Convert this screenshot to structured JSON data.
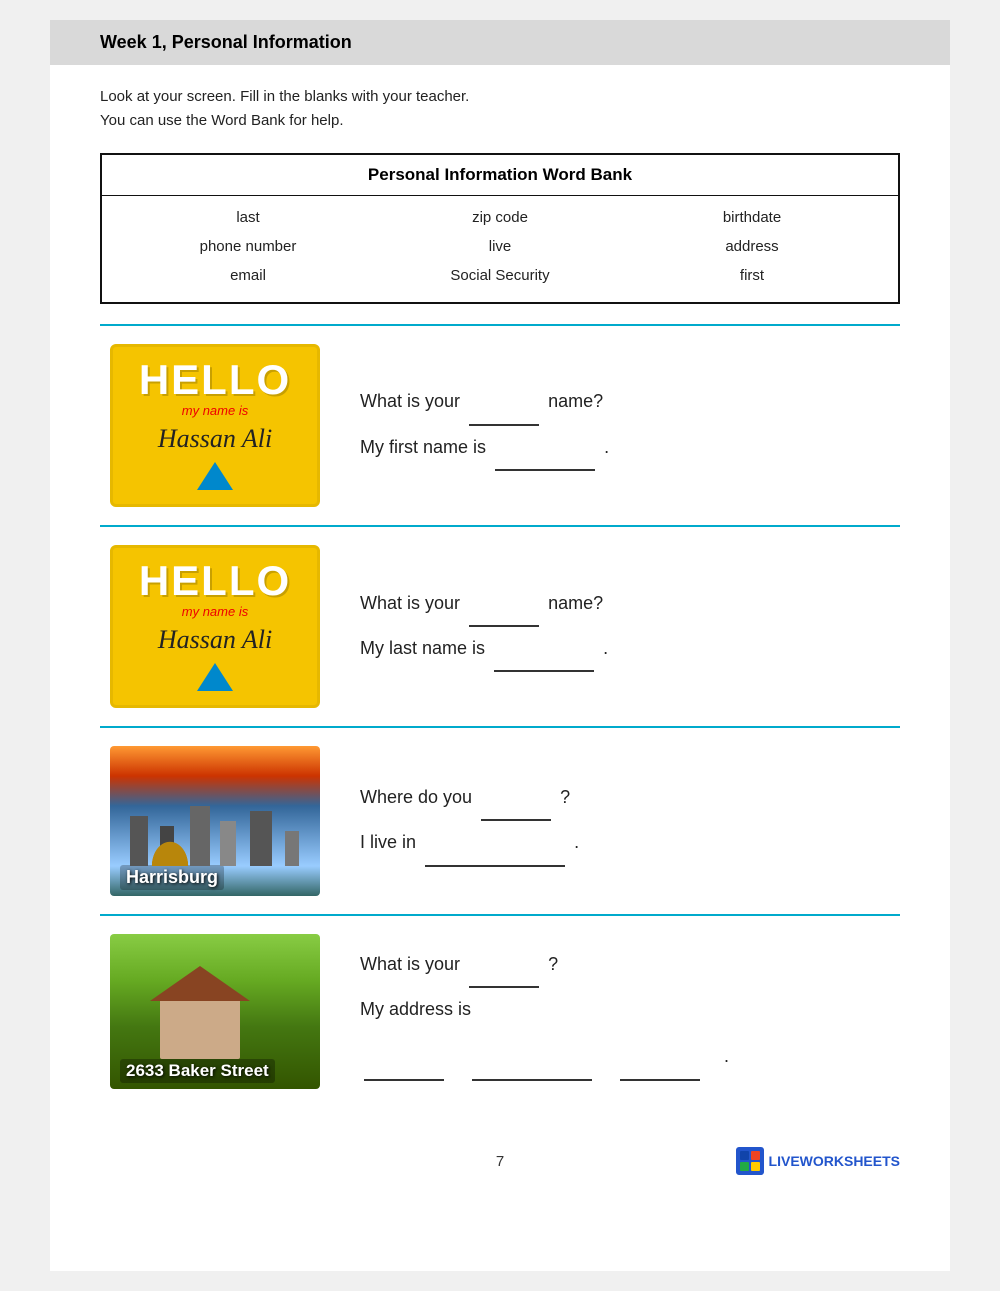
{
  "header": {
    "title": "Week 1, Personal Information",
    "background": "#d9d9d9"
  },
  "instructions": {
    "line1": "Look at your screen.  Fill in the blanks with your teacher.",
    "line2": "You can use the Word Bank for help."
  },
  "wordBank": {
    "title": "Personal Information Word Bank",
    "items": [
      [
        "last",
        "zip code",
        "birthdate"
      ],
      [
        "phone number",
        "live",
        "address"
      ],
      [
        "email",
        "Social Security",
        "first"
      ]
    ]
  },
  "sections": [
    {
      "id": "section-first-name",
      "badge": {
        "hello": "HELLO",
        "myNameIs": "my name is",
        "name": "Hassan Ali"
      },
      "q1": "What is your",
      "q1_blank": "",
      "q1_suffix": "name?",
      "q2": "My first name is",
      "q2_blank": "",
      "q2_suffix": "."
    },
    {
      "id": "section-last-name",
      "badge": {
        "hello": "HELLO",
        "myNameIs": "my name is",
        "name": "Hassan Ali"
      },
      "q1": "What is your",
      "q1_blank": "",
      "q1_suffix": "name?",
      "q2": "My last name is",
      "q2_blank": "",
      "q2_suffix": "."
    },
    {
      "id": "section-city",
      "cityLabel": "Harrisburg",
      "q1": "Where do you",
      "q1_blank": "",
      "q1_suffix": "?",
      "q2": "I live in",
      "q2_blank": "",
      "q2_suffix": "."
    },
    {
      "id": "section-address",
      "addressLabel": "2633 Baker Street",
      "q1": "What is your",
      "q1_blank": "",
      "q1_suffix": "?",
      "q2": "My address is",
      "addr_blank1": "",
      "addr_blank2": "",
      "addr_blank3": "",
      "addr_suffix": "."
    }
  ],
  "footer": {
    "pageNumber": "7",
    "logoText": "LIVEWORKSHEETS"
  }
}
